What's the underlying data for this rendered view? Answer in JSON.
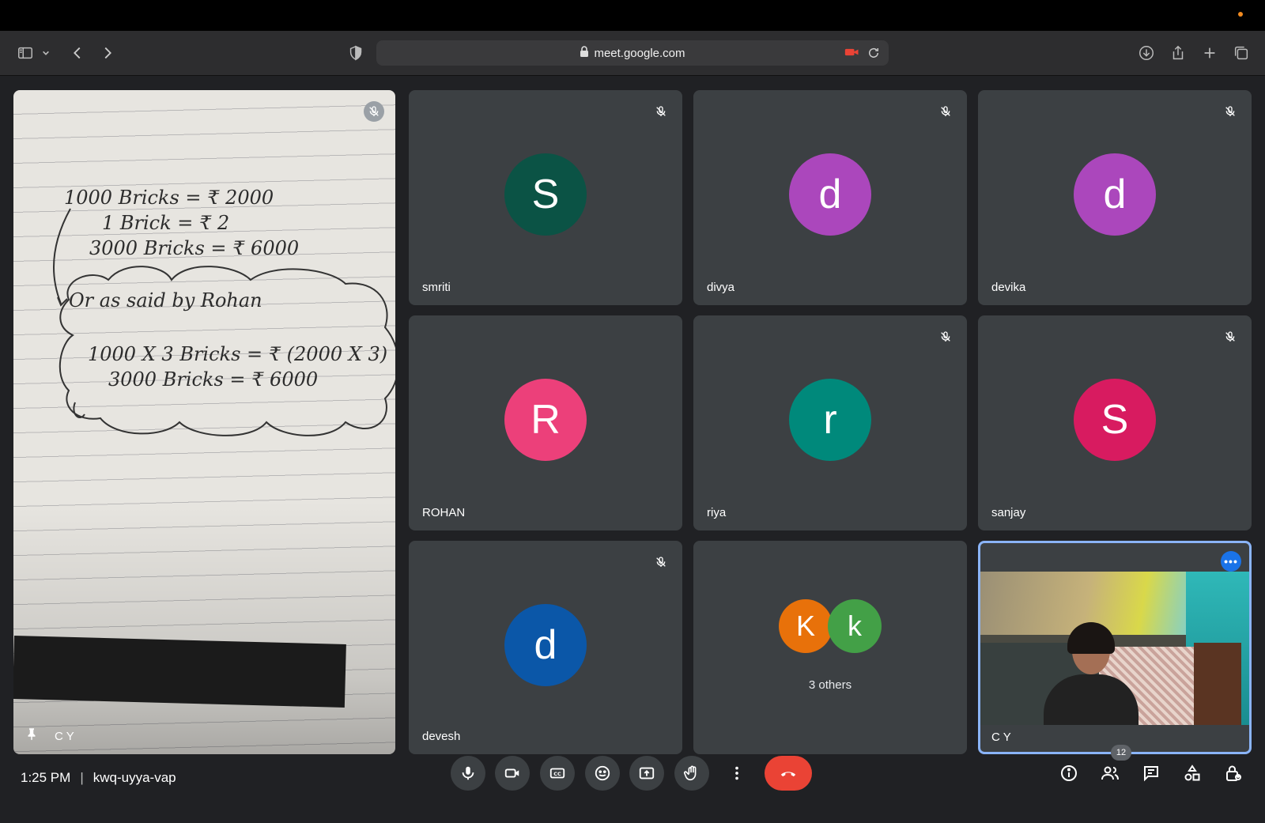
{
  "browser": {
    "url": "meet.google.com"
  },
  "participants": [
    {
      "name": "smriti",
      "initial": "S",
      "color": "#0b5345",
      "muted": true
    },
    {
      "name": "divya",
      "initial": "d",
      "color": "#ab47bc",
      "muted": true
    },
    {
      "name": "devika",
      "initial": "d",
      "color": "#ab47bc",
      "muted": true
    },
    {
      "name": "ROHAN",
      "initial": "R",
      "color": "#ec407a",
      "muted": false
    },
    {
      "name": "riya",
      "initial": "r",
      "color": "#00897b",
      "muted": true
    },
    {
      "name": "sanjay",
      "initial": "S",
      "color": "#d81b60",
      "muted": true
    },
    {
      "name": "devesh",
      "initial": "d",
      "color": "#0b57a8",
      "muted": true
    }
  ],
  "presenter": {
    "name": "C Y",
    "notes": [
      "1000 Bricks  = ₹ 2000",
      "1 Brick  =  ₹ 2",
      "3000 Bricks  =  ₹ 6000",
      "Or  as  said  by  Rohan",
      "1000 X 3   Bricks  = ₹ (2000 X 3)",
      "3000  Bricks   =  ₹ 6000"
    ]
  },
  "others": {
    "label": "3 others",
    "initials": [
      "K",
      "k"
    ],
    "colors": [
      "#e8710a",
      "#43a047"
    ]
  },
  "self": {
    "name": "C Y",
    "more": "•••"
  },
  "meeting": {
    "time": "1:25 PM",
    "separator": "|",
    "code": "kwq-uyya-vap",
    "participant_count": "12"
  },
  "colors": {
    "background": "#202124",
    "tile": "#3c4043",
    "end_call": "#ea4335",
    "self_border": "#8ab4f8"
  }
}
